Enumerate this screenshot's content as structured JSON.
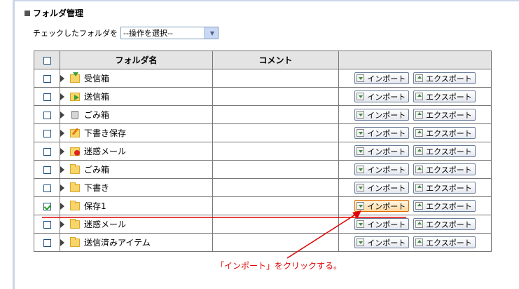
{
  "title": "フォルダ管理",
  "bulk_action": {
    "label": "チェックしたフォルダを",
    "select_value": "--操作を選択--"
  },
  "table": {
    "headers": {
      "name": "フォルダ名",
      "comment": "コメント",
      "actions": ""
    },
    "import_label": "インポート",
    "export_label": "エクスポート",
    "rows": [
      {
        "name": "受信箱",
        "icon": "inbox-icon",
        "checked": false
      },
      {
        "name": "送信箱",
        "icon": "outbox-icon",
        "checked": false
      },
      {
        "name": "ごみ箱",
        "icon": "trash-icon",
        "checked": false
      },
      {
        "name": "下書き保存",
        "icon": "draft-icon",
        "checked": false
      },
      {
        "name": "迷惑メール",
        "icon": "spam-icon",
        "checked": false
      },
      {
        "name": "ごみ箱",
        "icon": "folder-icon",
        "checked": false
      },
      {
        "name": "下書き",
        "icon": "folder-icon",
        "checked": false
      },
      {
        "name": "保存1",
        "icon": "folder-icon",
        "checked": true
      },
      {
        "name": "迷惑メール",
        "icon": "folder-icon",
        "checked": false
      },
      {
        "name": "送信済みアイテム",
        "icon": "folder-icon",
        "checked": false
      }
    ]
  },
  "annotation": "「インポート」をクリックする。",
  "colors": {
    "annotation": "#e00000",
    "highlight": "#e06a00"
  }
}
